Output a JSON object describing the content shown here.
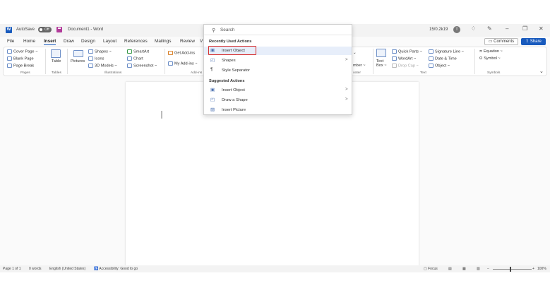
{
  "window": {
    "app_logo": "W",
    "autosave_label": "AutoSave",
    "autosave_state": "Off",
    "doc_title": "Document1 - Word",
    "user_name": "15/0.2k19",
    "avatar_initial": "T"
  },
  "tabs": [
    "File",
    "Home",
    "Insert",
    "Draw",
    "Design",
    "Layout",
    "References",
    "Mailings",
    "Review",
    "V"
  ],
  "active_tab": "Insert",
  "actions": {
    "comments": "Comments",
    "share": "Share"
  },
  "ribbon": {
    "pages": {
      "items": [
        "Cover Page ~",
        "Blank Page",
        "Page Break"
      ],
      "label": "Pages"
    },
    "tables": {
      "item": "Table",
      "label": "Tables"
    },
    "illustrations": {
      "pictures": "Pictures",
      "shapes": "Shapes ~",
      "icons": "Icons",
      "models3d": "3D Models ~",
      "smartart": "SmartArt",
      "chart": "Chart",
      "screenshot": "Screenshot ~",
      "label": "Illustrations"
    },
    "addins": {
      "get": "Get Add-ins",
      "my": "My Add-ins ~",
      "label": "Add-ins"
    },
    "header_footer": {
      "number": "mber ~",
      "label": "ooter"
    },
    "text": {
      "textbox": "Text Box ~",
      "quickparts": "Quick Parts ~",
      "wordart": "WordArt ~",
      "dropcap": "Drop Cap ~",
      "signature": "Signature Line ~",
      "datetime": "Date & Time",
      "object": "Object ~",
      "label": "Text"
    },
    "symbols": {
      "equation": "Equation ~",
      "symbol": "Symbol ~",
      "label": "Symbols"
    }
  },
  "search": {
    "placeholder": "Search",
    "recent_heading": "Recently Used Actions",
    "recent": [
      {
        "label": "Insert Object",
        "icon": "object-icon",
        "chevron": ""
      },
      {
        "label": "Shapes",
        "icon": "shapes-icon",
        "chevron": ">"
      },
      {
        "label": "Style Separator",
        "icon": "pilcrow-icon",
        "chevron": ""
      }
    ],
    "suggested_heading": "Suggested Actions",
    "suggested": [
      {
        "label": "Insert Object",
        "icon": "object-icon",
        "chevron": ">"
      },
      {
        "label": "Draw a Shape",
        "icon": "shapes-icon",
        "chevron": ">"
      },
      {
        "label": "Insert Picture",
        "icon": "picture-icon",
        "chevron": ""
      }
    ]
  },
  "status": {
    "page": "Page 1 of 1",
    "words": "0 words",
    "language": "English (United States)",
    "accessibility": "Accessibility: Good to go",
    "focus": "Focus",
    "zoom": "100%"
  },
  "colors": {
    "accent": "#185abd",
    "highlight_box": "#d62a2a",
    "hover": "#e7eefa"
  }
}
